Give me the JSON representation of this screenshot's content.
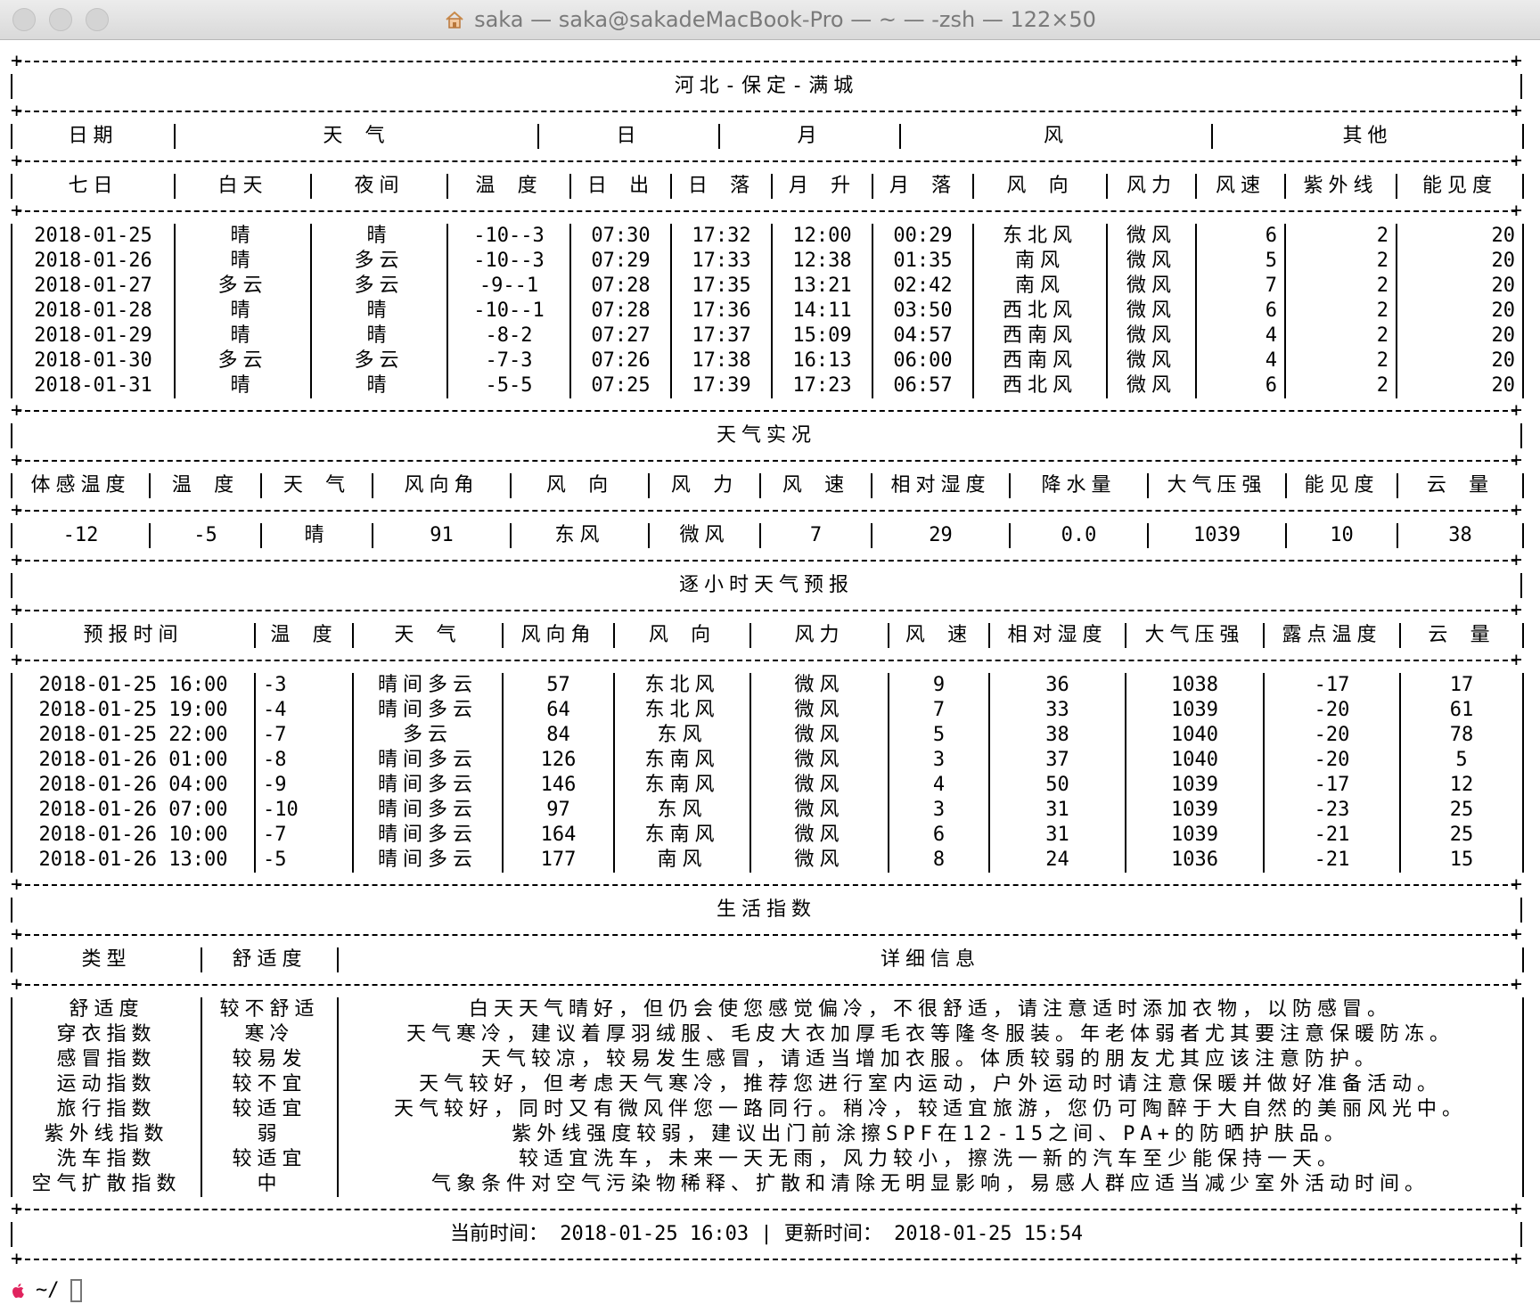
{
  "window": {
    "title": "saka — saka@sakadeMacBook-Pro — ~ — -zsh — 122×50",
    "icon": "home-icon"
  },
  "location": "河北-保定-满城",
  "forecast": {
    "group_headers": [
      "日期",
      "天  气",
      "日",
      "月",
      "风",
      "其他"
    ],
    "headers": [
      "七日",
      "白天",
      "夜间",
      "温 度",
      "日 出",
      "日 落",
      "月 升",
      "月 落",
      "风  向",
      "风力",
      "风速",
      "紫外线",
      "能见度"
    ],
    "rows": [
      [
        "2018-01-25",
        "晴",
        "晴",
        "-10--3",
        "07:30",
        "17:32",
        "12:00",
        "00:29",
        "东北风",
        "微风",
        "6",
        "2",
        "20"
      ],
      [
        "2018-01-26",
        "晴",
        "多云",
        "-10--3",
        "07:29",
        "17:33",
        "12:38",
        "01:35",
        "南风",
        "微风",
        "5",
        "2",
        "20"
      ],
      [
        "2018-01-27",
        "多云",
        "多云",
        "-9--1",
        "07:28",
        "17:35",
        "13:21",
        "02:42",
        "南风",
        "微风",
        "7",
        "2",
        "20"
      ],
      [
        "2018-01-28",
        "晴",
        "晴",
        "-10--1",
        "07:28",
        "17:36",
        "14:11",
        "03:50",
        "西北风",
        "微风",
        "6",
        "2",
        "20"
      ],
      [
        "2018-01-29",
        "晴",
        "晴",
        "-8-2",
        "07:27",
        "17:37",
        "15:09",
        "04:57",
        "西南风",
        "微风",
        "4",
        "2",
        "20"
      ],
      [
        "2018-01-30",
        "多云",
        "多云",
        "-7-3",
        "07:26",
        "17:38",
        "16:13",
        "06:00",
        "西南风",
        "微风",
        "4",
        "2",
        "20"
      ],
      [
        "2018-01-31",
        "晴",
        "晴",
        "-5-5",
        "07:25",
        "17:39",
        "17:23",
        "06:57",
        "西北风",
        "微风",
        "6",
        "2",
        "20"
      ]
    ]
  },
  "current": {
    "title": "天气实况",
    "headers": [
      "体感温度",
      "温  度",
      "天  气",
      "风向角",
      "风  向",
      "风  力",
      "风  速",
      "相对湿度",
      "降水量",
      "大气压强",
      "能见度",
      "云  量"
    ],
    "values": [
      "-12",
      "-5",
      "晴",
      "91",
      "东风",
      "微风",
      "7",
      "29",
      "0.0",
      "1039",
      "10",
      "38"
    ]
  },
  "hourly": {
    "title": "逐小时天气预报",
    "headers": [
      "预报时间",
      "温 度",
      "天 气",
      "风向角",
      "风  向",
      "风力",
      "风 速",
      "相对湿度",
      "大气压强",
      "露点温度",
      "云  量"
    ],
    "rows": [
      [
        "2018-01-25 16:00",
        "-3",
        "晴间多云",
        "57",
        "东北风",
        "微风",
        "9",
        "36",
        "1038",
        "-17",
        "17"
      ],
      [
        "2018-01-25 19:00",
        "-4",
        "晴间多云",
        "64",
        "东北风",
        "微风",
        "7",
        "33",
        "1039",
        "-20",
        "61"
      ],
      [
        "2018-01-25 22:00",
        "-7",
        "多云",
        "84",
        "东风",
        "微风",
        "5",
        "38",
        "1040",
        "-20",
        "78"
      ],
      [
        "2018-01-26 01:00",
        "-8",
        "晴间多云",
        "126",
        "东南风",
        "微风",
        "3",
        "37",
        "1040",
        "-20",
        "5"
      ],
      [
        "2018-01-26 04:00",
        "-9",
        "晴间多云",
        "146",
        "东南风",
        "微风",
        "4",
        "50",
        "1039",
        "-17",
        "12"
      ],
      [
        "2018-01-26 07:00",
        "-10",
        "晴间多云",
        "97",
        "东风",
        "微风",
        "3",
        "31",
        "1039",
        "-23",
        "25"
      ],
      [
        "2018-01-26 10:00",
        "-7",
        "晴间多云",
        "164",
        "东南风",
        "微风",
        "6",
        "31",
        "1039",
        "-21",
        "25"
      ],
      [
        "2018-01-26 13:00",
        "-5",
        "晴间多云",
        "177",
        "南风",
        "微风",
        "8",
        "24",
        "1036",
        "-21",
        "15"
      ]
    ]
  },
  "life": {
    "title": "生活指数",
    "headers": [
      "类型",
      "舒适度",
      "详细信息"
    ],
    "rows": [
      [
        "舒适度",
        "较不舒适",
        "白天天气晴好，但仍会使您感觉偏冷，不很舒适，请注意适时添加衣物，以防感冒。"
      ],
      [
        "穿衣指数",
        "寒冷",
        "天气寒冷，建议着厚羽绒服、毛皮大衣加厚毛衣等隆冬服装。年老体弱者尤其要注意保暖防冻。"
      ],
      [
        "感冒指数",
        "较易发",
        "天气较凉，较易发生感冒，请适当增加衣服。体质较弱的朋友尤其应该注意防护。"
      ],
      [
        "运动指数",
        "较不宜",
        "天气较好，但考虑天气寒冷，推荐您进行室内运动，户外运动时请注意保暖并做好准备活动。"
      ],
      [
        "旅行指数",
        "较适宜",
        "天气较好，同时又有微风伴您一路同行。稍冷，较适宜旅游，您仍可陶醉于大自然的美丽风光中。"
      ],
      [
        "紫外线指数",
        "弱",
        "紫外线强度较弱，建议出门前涂擦SPF在12-15之间、PA+的防晒护肤品。"
      ],
      [
        "洗车指数",
        "较适宜",
        "较适宜洗车，未来一天无雨，风力较小，擦洗一新的汽车至少能保持一天。"
      ],
      [
        "空气扩散指数",
        "中",
        "气象条件对空气污染物稀释、扩散和清除无明显影响，易感人群应适当减少室外活动时间。"
      ]
    ]
  },
  "footer": {
    "text": "当前时间： 2018-01-25 16:03 | 更新时间： 2018-01-25 15:54"
  },
  "prompt": {
    "text": "~/"
  }
}
